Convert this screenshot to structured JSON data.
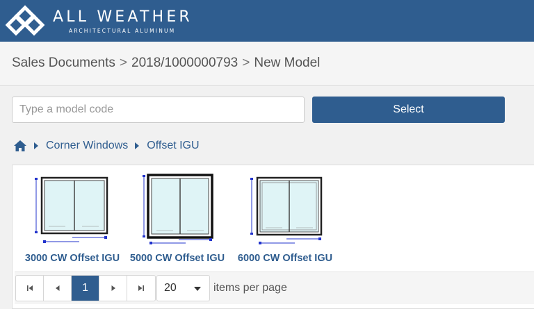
{
  "header": {
    "brand_name": "ALL WEATHER",
    "brand_sub": "ARCHITECTURAL ALUMINUM",
    "logo_icon": "diamond-logo-icon"
  },
  "breadcrumb": {
    "items": [
      "Sales Documents",
      "2018/1000000793",
      "New Model"
    ],
    "separator": ">"
  },
  "search": {
    "placeholder": "Type a model code",
    "value": "",
    "button_label": "Select"
  },
  "category_path": {
    "home_icon": "home-icon",
    "items": [
      "Corner Windows",
      "Offset IGU"
    ]
  },
  "models": [
    {
      "label": "3000 CW Offset IGU"
    },
    {
      "label": "5000 CW Offset IGU"
    },
    {
      "label": "6000 CW Offset IGU"
    }
  ],
  "pager": {
    "first_icon": "first-page-icon",
    "prev_icon": "prev-page-icon",
    "current_page": "1",
    "next_icon": "next-page-icon",
    "last_icon": "last-page-icon",
    "page_size": "20",
    "page_size_label": "items per page"
  },
  "colors": {
    "brand": "#2f5d8f",
    "page_bg": "#f1f1f1",
    "dimension_lines": "#2233cc"
  }
}
